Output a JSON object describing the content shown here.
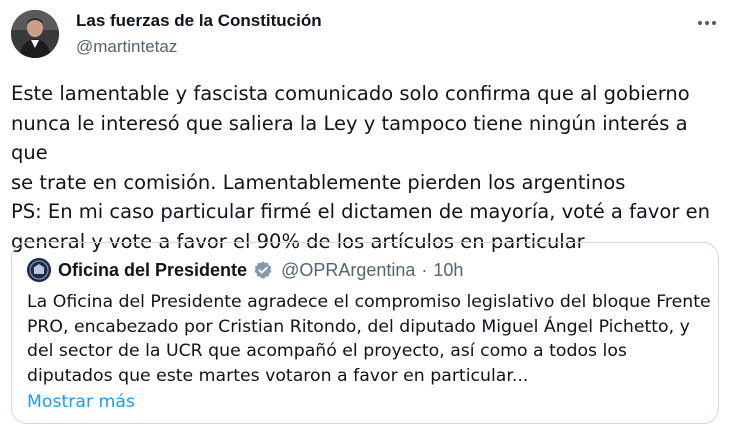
{
  "author": {
    "display_name": "Las fuerzas de la Constitución",
    "handle": "@martintetaz"
  },
  "tweet": {
    "text": "Este lamentable y fascista comunicado solo confirma que al gobierno\nnunca le interesó que saliera la Ley y tampoco tiene ningún interés a que\nse trate en comisión. Lamentablemente pierden los argentinos\nPS: En mi caso particular firmé el dictamen de mayoría, voté a favor en\ngeneral y vote a favor el 90% de los artículos en particular"
  },
  "quoted_tweet": {
    "display_name": "Oficina del Presidente",
    "handle": "@OPRArgentina",
    "separator": "·",
    "time": "10h",
    "text": "La Oficina del Presidente agradece el compromiso legislativo del bloque Frente\nPRO, encabezado por Cristian Ritondo, del diputado Miguel Ángel Pichetto, y\ndel sector de la UCR que acompañó el proyecto, así como a todos los\ndiputados que este martes votaron a favor en particular...",
    "show_more_label": "Mostrar más"
  },
  "icons": {
    "more": "more-horizontal-icon",
    "verified": "verified-badge-icon"
  },
  "colors": {
    "link": "#1d9bf0",
    "secondary_text": "#536471",
    "border": "#cfd9de",
    "verified_badge": "#829aab"
  }
}
